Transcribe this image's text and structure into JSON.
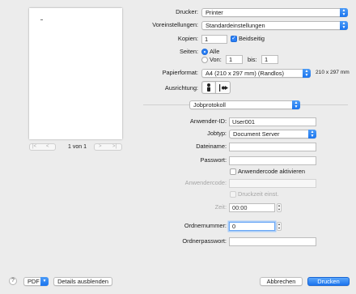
{
  "preview": {
    "page_indicator": "1 von 1",
    "first_btn": "|<",
    "prev_btn": "<",
    "next_btn": ">",
    "last_btn": ">|"
  },
  "printer": {
    "label": "Drucker:",
    "value": "Printer"
  },
  "presets": {
    "label": "Voreinstellungen:",
    "value": "Standardeinstellungen"
  },
  "copies": {
    "label": "Kopien:",
    "value": "1",
    "duplex_label": "Beidseitig"
  },
  "pages": {
    "label": "Seiten:",
    "all_label": "Alle",
    "from_label": "Von:",
    "from_value": "1",
    "to_label": "bis:",
    "to_value": "1"
  },
  "paper": {
    "label": "Papierformat:",
    "value": "A4 (210 x 297 mm) (Randlos)",
    "size_text": "210 x 297 mm"
  },
  "orientation": {
    "label": "Ausrichtung:"
  },
  "section": {
    "value": "Jobprotokoll"
  },
  "job": {
    "user_id_label": "Anwender-ID:",
    "user_id_value": "User001",
    "type_label": "Jobtyp:",
    "type_value": "Document Server",
    "filename_label": "Dateiname:",
    "filename_value": "",
    "password_label": "Passwort:",
    "password_value": "",
    "usercode_enable_label": "Anwendercode aktivieren",
    "usercode_label": "Anwendercode:",
    "usercode_value": "",
    "print_time_label": "Druckzeit einst.",
    "time_label": "Zeit:",
    "time_value": "00:00",
    "folder_number_label": "Ordnernummer:",
    "folder_number_value": "0",
    "folder_password_label": "Ordnerpasswort:",
    "folder_password_value": ""
  },
  "footer": {
    "help": "?",
    "pdf": "PDF",
    "hide_details": "Details ausblenden",
    "cancel": "Abbrechen",
    "print": "Drucken"
  },
  "colors": {
    "accent": "#1c75ef",
    "window": "#ececec"
  }
}
